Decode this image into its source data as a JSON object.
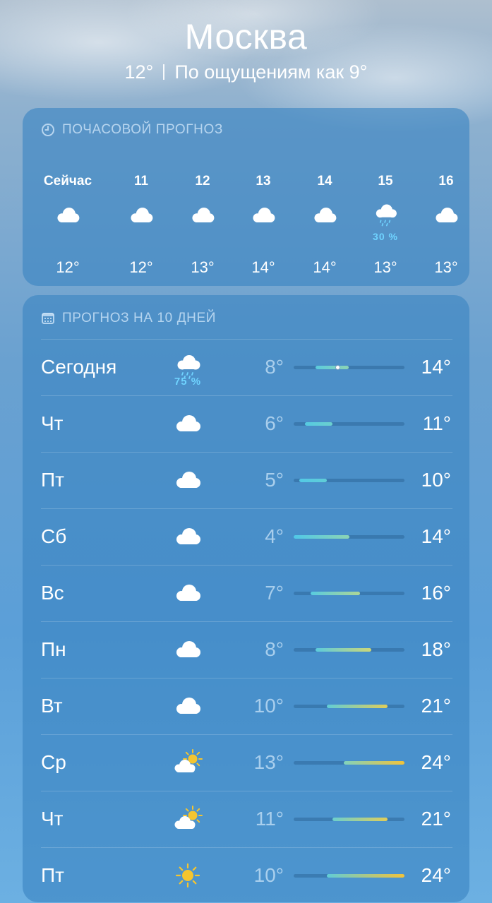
{
  "location": {
    "city": "Москва",
    "temp": "12°",
    "feels_like": "По ощущениям как 9°"
  },
  "hourly": {
    "title": "ПОЧАСОВОЙ ПРОГНОЗ",
    "title_icon": "clock-icon",
    "items": [
      {
        "label": "Сейчас",
        "icon": "cloud-icon",
        "temp": "12°"
      },
      {
        "label": "11",
        "icon": "cloud-icon",
        "temp": "12°"
      },
      {
        "label": "12",
        "icon": "cloud-icon",
        "temp": "13°"
      },
      {
        "label": "13",
        "icon": "cloud-icon",
        "temp": "14°"
      },
      {
        "label": "14",
        "icon": "cloud-icon",
        "temp": "14°"
      },
      {
        "label": "15",
        "icon": "cloud-rain-icon",
        "precip": "30 %",
        "temp": "13°"
      },
      {
        "label": "16",
        "icon": "cloud-icon",
        "temp": "13°"
      }
    ]
  },
  "daily": {
    "title": "ПРОГНОЗ НА 10 ДНЕЙ",
    "title_icon": "calendar-icon",
    "scale_min": 4,
    "scale_max": 24,
    "current_temp": 12,
    "days": [
      {
        "day": "Сегодня",
        "icon": "cloud-rain-icon",
        "precip": "75 %",
        "low": "8°",
        "high": "14°",
        "low_val": 8,
        "high_val": 14,
        "current": true
      },
      {
        "day": "Чт",
        "icon": "cloud-icon",
        "low": "6°",
        "high": "11°",
        "low_val": 6,
        "high_val": 11
      },
      {
        "day": "Пт",
        "icon": "cloud-icon",
        "low": "5°",
        "high": "10°",
        "low_val": 5,
        "high_val": 10
      },
      {
        "day": "Сб",
        "icon": "cloud-icon",
        "low": "4°",
        "high": "14°",
        "low_val": 4,
        "high_val": 14
      },
      {
        "day": "Вс",
        "icon": "cloud-icon",
        "low": "7°",
        "high": "16°",
        "low_val": 7,
        "high_val": 16
      },
      {
        "day": "Пн",
        "icon": "cloud-icon",
        "low": "8°",
        "high": "18°",
        "low_val": 8,
        "high_val": 18
      },
      {
        "day": "Вт",
        "icon": "cloud-icon",
        "low": "10°",
        "high": "21°",
        "low_val": 10,
        "high_val": 21
      },
      {
        "day": "Ср",
        "icon": "partly-sunny-icon",
        "low": "13°",
        "high": "24°",
        "low_val": 13,
        "high_val": 24
      },
      {
        "day": "Чт",
        "icon": "partly-sunny-icon",
        "low": "11°",
        "high": "21°",
        "low_val": 11,
        "high_val": 21
      },
      {
        "day": "Пт",
        "icon": "sun-icon",
        "low": "10°",
        "high": "24°",
        "low_val": 10,
        "high_val": 24
      }
    ]
  },
  "colors": {
    "precip": "#6fd3ff",
    "cool": "#5ccde6",
    "warm": "#f2c33a"
  }
}
